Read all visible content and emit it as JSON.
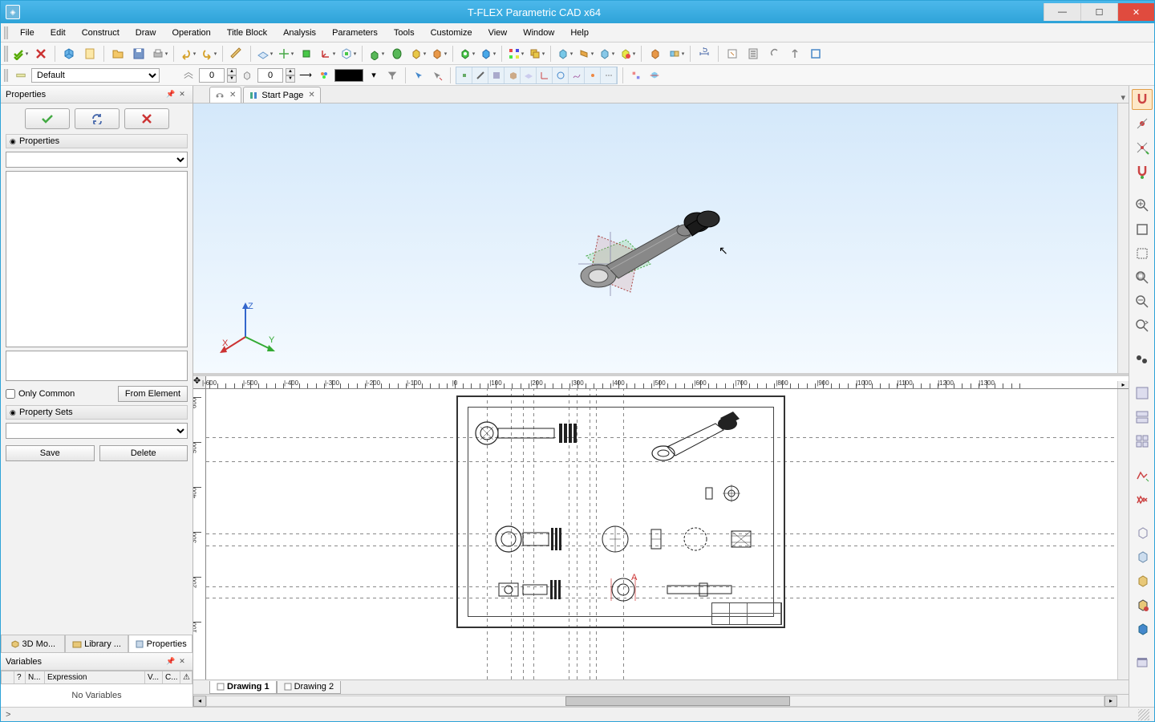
{
  "title": "T-FLEX Parametric CAD x64",
  "menu": [
    "File",
    "Edit",
    "Construct",
    "Draw",
    "Operation",
    "Title Block",
    "Analysis",
    "Parameters",
    "Tools",
    "Customize",
    "View",
    "Window",
    "Help"
  ],
  "toolbar2": {
    "layer_label": "Default",
    "level1": "0",
    "level2": "0"
  },
  "properties": {
    "panel_title": "Properties",
    "section_title": "Properties",
    "only_common": "Only Common",
    "from_element": "From Element",
    "property_sets": "Property Sets",
    "save": "Save",
    "delete": "Delete",
    "tabs": [
      "3D Mo...",
      "Library ...",
      "Properties"
    ]
  },
  "variables": {
    "panel_title": "Variables",
    "cols": [
      "",
      "?",
      "N...",
      "Expression",
      "V...",
      "C...",
      ""
    ],
    "empty": "No Variables"
  },
  "doctabs": {
    "tab1_icon": "part-icon",
    "tab2": "Start Page"
  },
  "sheettabs": [
    "Drawing 1",
    "Drawing 2"
  ],
  "ruler": {
    "h": [
      "-600",
      "-500",
      "-400",
      "-300",
      "-200",
      "-100",
      "0",
      "100",
      "200",
      "300",
      "400",
      "500",
      "600",
      "700",
      "800",
      "900",
      "1000",
      "1100",
      "1200",
      "1300"
    ],
    "v": [
      "600",
      "500",
      "400",
      "300",
      "200",
      "100"
    ]
  },
  "triad": {
    "x": "X",
    "y": "Y",
    "z": "Z"
  },
  "status": ">"
}
